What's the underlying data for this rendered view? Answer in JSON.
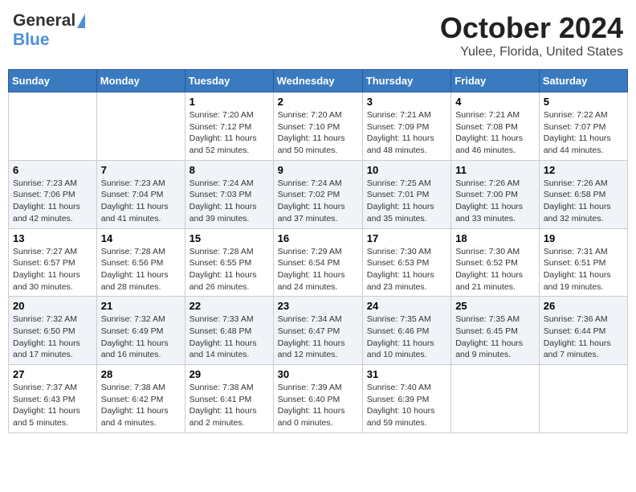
{
  "header": {
    "logo_general": "General",
    "logo_blue": "Blue",
    "month_year": "October 2024",
    "location": "Yulee, Florida, United States"
  },
  "weekdays": [
    "Sunday",
    "Monday",
    "Tuesday",
    "Wednesday",
    "Thursday",
    "Friday",
    "Saturday"
  ],
  "weeks": [
    [
      {
        "day": "",
        "info": ""
      },
      {
        "day": "",
        "info": ""
      },
      {
        "day": "1",
        "sunrise": "Sunrise: 7:20 AM",
        "sunset": "Sunset: 7:12 PM",
        "daylight": "Daylight: 11 hours and 52 minutes."
      },
      {
        "day": "2",
        "sunrise": "Sunrise: 7:20 AM",
        "sunset": "Sunset: 7:10 PM",
        "daylight": "Daylight: 11 hours and 50 minutes."
      },
      {
        "day": "3",
        "sunrise": "Sunrise: 7:21 AM",
        "sunset": "Sunset: 7:09 PM",
        "daylight": "Daylight: 11 hours and 48 minutes."
      },
      {
        "day": "4",
        "sunrise": "Sunrise: 7:21 AM",
        "sunset": "Sunset: 7:08 PM",
        "daylight": "Daylight: 11 hours and 46 minutes."
      },
      {
        "day": "5",
        "sunrise": "Sunrise: 7:22 AM",
        "sunset": "Sunset: 7:07 PM",
        "daylight": "Daylight: 11 hours and 44 minutes."
      }
    ],
    [
      {
        "day": "6",
        "sunrise": "Sunrise: 7:23 AM",
        "sunset": "Sunset: 7:06 PM",
        "daylight": "Daylight: 11 hours and 42 minutes."
      },
      {
        "day": "7",
        "sunrise": "Sunrise: 7:23 AM",
        "sunset": "Sunset: 7:04 PM",
        "daylight": "Daylight: 11 hours and 41 minutes."
      },
      {
        "day": "8",
        "sunrise": "Sunrise: 7:24 AM",
        "sunset": "Sunset: 7:03 PM",
        "daylight": "Daylight: 11 hours and 39 minutes."
      },
      {
        "day": "9",
        "sunrise": "Sunrise: 7:24 AM",
        "sunset": "Sunset: 7:02 PM",
        "daylight": "Daylight: 11 hours and 37 minutes."
      },
      {
        "day": "10",
        "sunrise": "Sunrise: 7:25 AM",
        "sunset": "Sunset: 7:01 PM",
        "daylight": "Daylight: 11 hours and 35 minutes."
      },
      {
        "day": "11",
        "sunrise": "Sunrise: 7:26 AM",
        "sunset": "Sunset: 7:00 PM",
        "daylight": "Daylight: 11 hours and 33 minutes."
      },
      {
        "day": "12",
        "sunrise": "Sunrise: 7:26 AM",
        "sunset": "Sunset: 6:58 PM",
        "daylight": "Daylight: 11 hours and 32 minutes."
      }
    ],
    [
      {
        "day": "13",
        "sunrise": "Sunrise: 7:27 AM",
        "sunset": "Sunset: 6:57 PM",
        "daylight": "Daylight: 11 hours and 30 minutes."
      },
      {
        "day": "14",
        "sunrise": "Sunrise: 7:28 AM",
        "sunset": "Sunset: 6:56 PM",
        "daylight": "Daylight: 11 hours and 28 minutes."
      },
      {
        "day": "15",
        "sunrise": "Sunrise: 7:28 AM",
        "sunset": "Sunset: 6:55 PM",
        "daylight": "Daylight: 11 hours and 26 minutes."
      },
      {
        "day": "16",
        "sunrise": "Sunrise: 7:29 AM",
        "sunset": "Sunset: 6:54 PM",
        "daylight": "Daylight: 11 hours and 24 minutes."
      },
      {
        "day": "17",
        "sunrise": "Sunrise: 7:30 AM",
        "sunset": "Sunset: 6:53 PM",
        "daylight": "Daylight: 11 hours and 23 minutes."
      },
      {
        "day": "18",
        "sunrise": "Sunrise: 7:30 AM",
        "sunset": "Sunset: 6:52 PM",
        "daylight": "Daylight: 11 hours and 21 minutes."
      },
      {
        "day": "19",
        "sunrise": "Sunrise: 7:31 AM",
        "sunset": "Sunset: 6:51 PM",
        "daylight": "Daylight: 11 hours and 19 minutes."
      }
    ],
    [
      {
        "day": "20",
        "sunrise": "Sunrise: 7:32 AM",
        "sunset": "Sunset: 6:50 PM",
        "daylight": "Daylight: 11 hours and 17 minutes."
      },
      {
        "day": "21",
        "sunrise": "Sunrise: 7:32 AM",
        "sunset": "Sunset: 6:49 PM",
        "daylight": "Daylight: 11 hours and 16 minutes."
      },
      {
        "day": "22",
        "sunrise": "Sunrise: 7:33 AM",
        "sunset": "Sunset: 6:48 PM",
        "daylight": "Daylight: 11 hours and 14 minutes."
      },
      {
        "day": "23",
        "sunrise": "Sunrise: 7:34 AM",
        "sunset": "Sunset: 6:47 PM",
        "daylight": "Daylight: 11 hours and 12 minutes."
      },
      {
        "day": "24",
        "sunrise": "Sunrise: 7:35 AM",
        "sunset": "Sunset: 6:46 PM",
        "daylight": "Daylight: 11 hours and 10 minutes."
      },
      {
        "day": "25",
        "sunrise": "Sunrise: 7:35 AM",
        "sunset": "Sunset: 6:45 PM",
        "daylight": "Daylight: 11 hours and 9 minutes."
      },
      {
        "day": "26",
        "sunrise": "Sunrise: 7:36 AM",
        "sunset": "Sunset: 6:44 PM",
        "daylight": "Daylight: 11 hours and 7 minutes."
      }
    ],
    [
      {
        "day": "27",
        "sunrise": "Sunrise: 7:37 AM",
        "sunset": "Sunset: 6:43 PM",
        "daylight": "Daylight: 11 hours and 5 minutes."
      },
      {
        "day": "28",
        "sunrise": "Sunrise: 7:38 AM",
        "sunset": "Sunset: 6:42 PM",
        "daylight": "Daylight: 11 hours and 4 minutes."
      },
      {
        "day": "29",
        "sunrise": "Sunrise: 7:38 AM",
        "sunset": "Sunset: 6:41 PM",
        "daylight": "Daylight: 11 hours and 2 minutes."
      },
      {
        "day": "30",
        "sunrise": "Sunrise: 7:39 AM",
        "sunset": "Sunset: 6:40 PM",
        "daylight": "Daylight: 11 hours and 0 minutes."
      },
      {
        "day": "31",
        "sunrise": "Sunrise: 7:40 AM",
        "sunset": "Sunset: 6:39 PM",
        "daylight": "Daylight: 10 hours and 59 minutes."
      },
      {
        "day": "",
        "info": ""
      },
      {
        "day": "",
        "info": ""
      }
    ]
  ]
}
